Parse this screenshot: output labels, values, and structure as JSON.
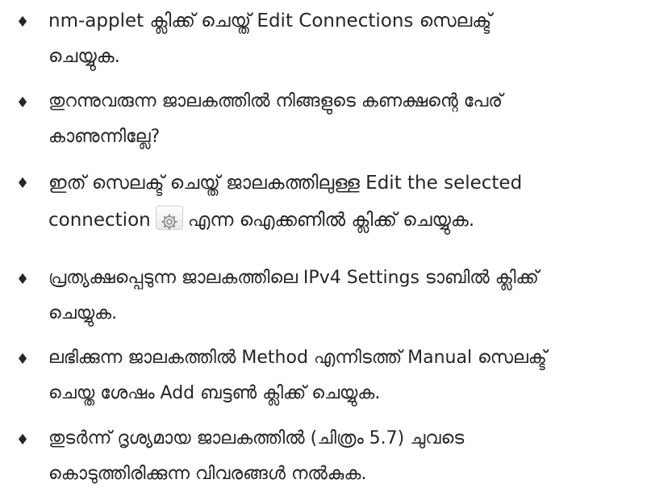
{
  "items": [
    {
      "bullet": "♦",
      "line1": "nm-applet ക്ലിക്ക് ചെയ്ത് Edit Connections സെലക്ട്",
      "line2": "ചെയ്യുക."
    },
    {
      "bullet": "♦",
      "line1": "തുറന്നുവരുന്ന ജാലകത്തിൽ നിങ്ങളുടെ കണക്ഷന്റെ പേര്",
      "line2": "കാണുന്നില്ലേ?"
    },
    {
      "bullet": "♦",
      "line1": "ഇത് സെലക്ട് ചെയ്ത് ജാലകത്തിലുള്ള Edit the selected",
      "line2_before_icon": "connection",
      "icon": "gear-icon",
      "line2_after_icon": "എന്ന ഐക്കണിൽ ക്ലിക്ക് ചെയ്യുക."
    },
    {
      "bullet": "♦",
      "line1": "പ്രത്യക്ഷപ്പെടുന്ന ജാലകത്തിലെ IPv4 Settings ടാബിൽ ക്ലിക്ക്",
      "line2": "ചെയ്യുക."
    },
    {
      "bullet": "♦",
      "line1": "ലഭിക്കുന്ന ജാലകത്തിൽ Method എന്നിടത്ത് Manual സെലക്ട്",
      "line2": "ചെയ്ത ശേഷം Add ബട്ടൺ ക്ലിക്ക് ചെയ്യുക."
    },
    {
      "bullet": "♦",
      "line1": "തുടർന്ന് ദൃശ്യമായ ജാലകത്തിൽ (ചിത്രം 5.7) ചുവടെ",
      "line2": "കൊടുത്തിരിക്കുന്ന വിവരങ്ങൾ നൽകുക."
    }
  ]
}
